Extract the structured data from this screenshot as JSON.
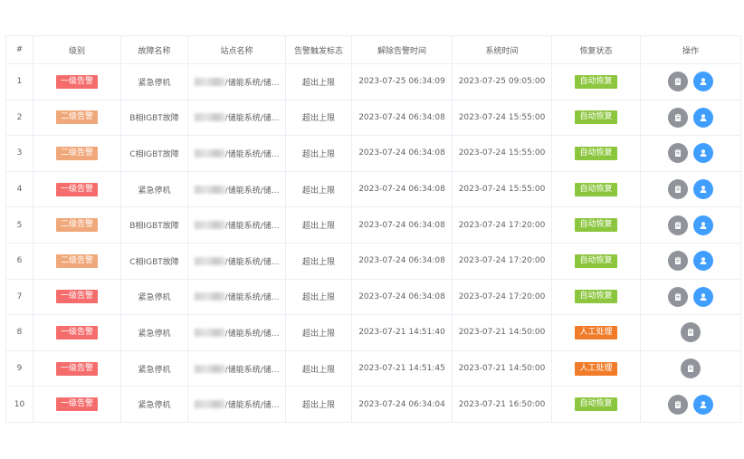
{
  "table": {
    "headers": [
      "#",
      "级别",
      "故障名称",
      "站点名称",
      "告警触发标志",
      "解除告警时间",
      "系统时间",
      "恢复状态",
      "操作"
    ],
    "rows": [
      {
        "index": "1",
        "level": "一级告警",
        "level_color": "#f56c6c",
        "fault": "紧急停机",
        "site": "/储能系统/储...",
        "trigger": "超出上限",
        "clear_time": "2023-07-25 06:34:09",
        "sys_time": "2023-07-25 09:05:00",
        "status": "自动恢复",
        "status_color": "#8cc63f",
        "actions": [
          "document",
          "user"
        ]
      },
      {
        "index": "2",
        "level": "二级告警",
        "level_color": "#f0a77a",
        "fault": "B相IGBT故障",
        "site": "/储能系统/储...",
        "trigger": "超出上限",
        "clear_time": "2023-07-24 06:34:08",
        "sys_time": "2023-07-24 15:55:00",
        "status": "自动恢复",
        "status_color": "#8cc63f",
        "actions": [
          "document",
          "user"
        ]
      },
      {
        "index": "3",
        "level": "二级告警",
        "level_color": "#f0a77a",
        "fault": "C相IGBT故障",
        "site": "/储能系统/储...",
        "trigger": "超出上限",
        "clear_time": "2023-07-24 06:34:08",
        "sys_time": "2023-07-24 15:55:00",
        "status": "自动恢复",
        "status_color": "#8cc63f",
        "actions": [
          "document",
          "user"
        ]
      },
      {
        "index": "4",
        "level": "一级告警",
        "level_color": "#f56c6c",
        "fault": "紧急停机",
        "site": "/储能系统/储...",
        "trigger": "超出上限",
        "clear_time": "2023-07-24 06:34:08",
        "sys_time": "2023-07-24 15:55:00",
        "status": "自动恢复",
        "status_color": "#8cc63f",
        "actions": [
          "document",
          "user"
        ]
      },
      {
        "index": "5",
        "level": "二级告警",
        "level_color": "#f0a77a",
        "fault": "B相IGBT故障",
        "site": "/储能系统/储...",
        "trigger": "超出上限",
        "clear_time": "2023-07-24 06:34:08",
        "sys_time": "2023-07-24 17:20:00",
        "status": "自动恢复",
        "status_color": "#8cc63f",
        "actions": [
          "document",
          "user"
        ]
      },
      {
        "index": "6",
        "level": "二级告警",
        "level_color": "#f0a77a",
        "fault": "C相IGBT故障",
        "site": "/储能系统/储...",
        "trigger": "超出上限",
        "clear_time": "2023-07-24 06:34:08",
        "sys_time": "2023-07-24 17:20:00",
        "status": "自动恢复",
        "status_color": "#8cc63f",
        "actions": [
          "document",
          "user"
        ]
      },
      {
        "index": "7",
        "level": "一级告警",
        "level_color": "#f56c6c",
        "fault": "紧急停机",
        "site": "/储能系统/储...",
        "trigger": "超出上限",
        "clear_time": "2023-07-24 06:34:08",
        "sys_time": "2023-07-24 17:20:00",
        "status": "自动恢复",
        "status_color": "#8cc63f",
        "actions": [
          "document",
          "user"
        ]
      },
      {
        "index": "8",
        "level": "一级告警",
        "level_color": "#f56c6c",
        "fault": "紧急停机",
        "site": "/储能系统/储...",
        "trigger": "超出上限",
        "clear_time": "2023-07-21 14:51:40",
        "sys_time": "2023-07-21 14:50:00",
        "status": "人工处理",
        "status_color": "#f07c2a",
        "actions": [
          "document"
        ]
      },
      {
        "index": "9",
        "level": "一级告警",
        "level_color": "#f56c6c",
        "fault": "紧急停机",
        "site": "/储能系统/储...",
        "trigger": "超出上限",
        "clear_time": "2023-07-21 14:51:45",
        "sys_time": "2023-07-21 14:50:00",
        "status": "人工处理",
        "status_color": "#f07c2a",
        "actions": [
          "document"
        ]
      },
      {
        "index": "10",
        "level": "一级告警",
        "level_color": "#f56c6c",
        "fault": "紧急停机",
        "site": "/储能系统/储...",
        "trigger": "超出上限",
        "clear_time": "2023-07-24 06:34:04",
        "sys_time": "2023-07-21 16:50:00",
        "status": "自动恢复",
        "status_color": "#8cc63f",
        "actions": [
          "document",
          "user"
        ]
      }
    ]
  },
  "colors": {
    "grey_button": "#909399",
    "blue_button": "#409eff",
    "border": "#ebeef5",
    "text": "#606266"
  },
  "icons": {
    "document": "clipboard-icon",
    "user": "user-icon"
  }
}
